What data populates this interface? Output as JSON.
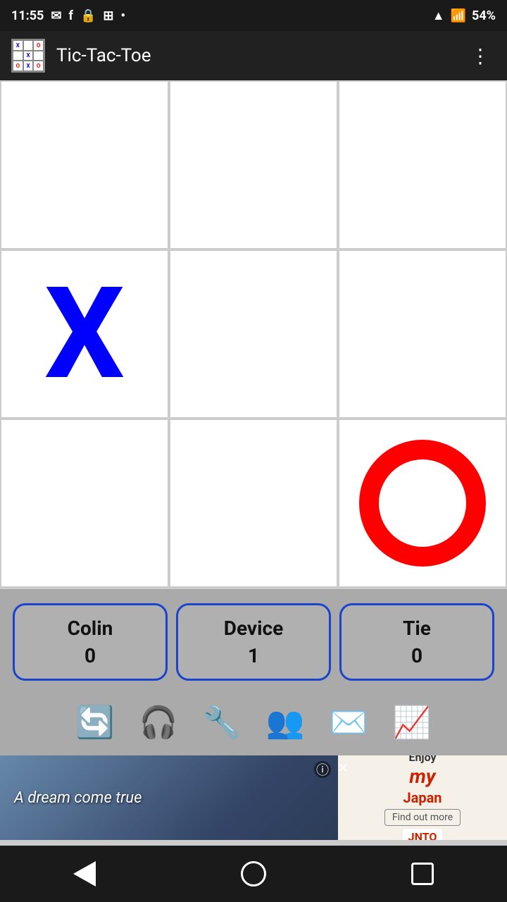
{
  "statusBar": {
    "time": "11:55",
    "battery": "54%"
  },
  "appBar": {
    "title": "Tic-Tac-Toe",
    "menuLabel": "⋮"
  },
  "board": {
    "cells": [
      {
        "row": 0,
        "col": 0,
        "value": ""
      },
      {
        "row": 0,
        "col": 1,
        "value": ""
      },
      {
        "row": 0,
        "col": 2,
        "value": ""
      },
      {
        "row": 1,
        "col": 0,
        "value": "X"
      },
      {
        "row": 1,
        "col": 1,
        "value": ""
      },
      {
        "row": 1,
        "col": 2,
        "value": ""
      },
      {
        "row": 2,
        "col": 0,
        "value": ""
      },
      {
        "row": 2,
        "col": 1,
        "value": ""
      },
      {
        "row": 2,
        "col": 2,
        "value": "O"
      }
    ]
  },
  "scores": [
    {
      "label": "Colin",
      "value": "0"
    },
    {
      "label": "Device",
      "value": "1"
    },
    {
      "label": "Tie",
      "value": "0"
    }
  ],
  "toolbar": {
    "buttons": [
      {
        "name": "refresh",
        "icon": "🔄"
      },
      {
        "name": "headset",
        "icon": "🎧"
      },
      {
        "name": "settings",
        "icon": "🔧"
      },
      {
        "name": "users",
        "icon": "👥"
      },
      {
        "name": "email",
        "icon": "✉️"
      },
      {
        "name": "chart",
        "icon": "📊"
      }
    ]
  },
  "ad": {
    "dreamText": "A dream come true",
    "enjoyLabel": "Enjoy",
    "brandName": "my",
    "japanLabel": "Japan",
    "findMore": "Find out more",
    "sponsor": "JNTO"
  },
  "nav": {
    "back": "◀",
    "home": "○",
    "recent": "□"
  }
}
